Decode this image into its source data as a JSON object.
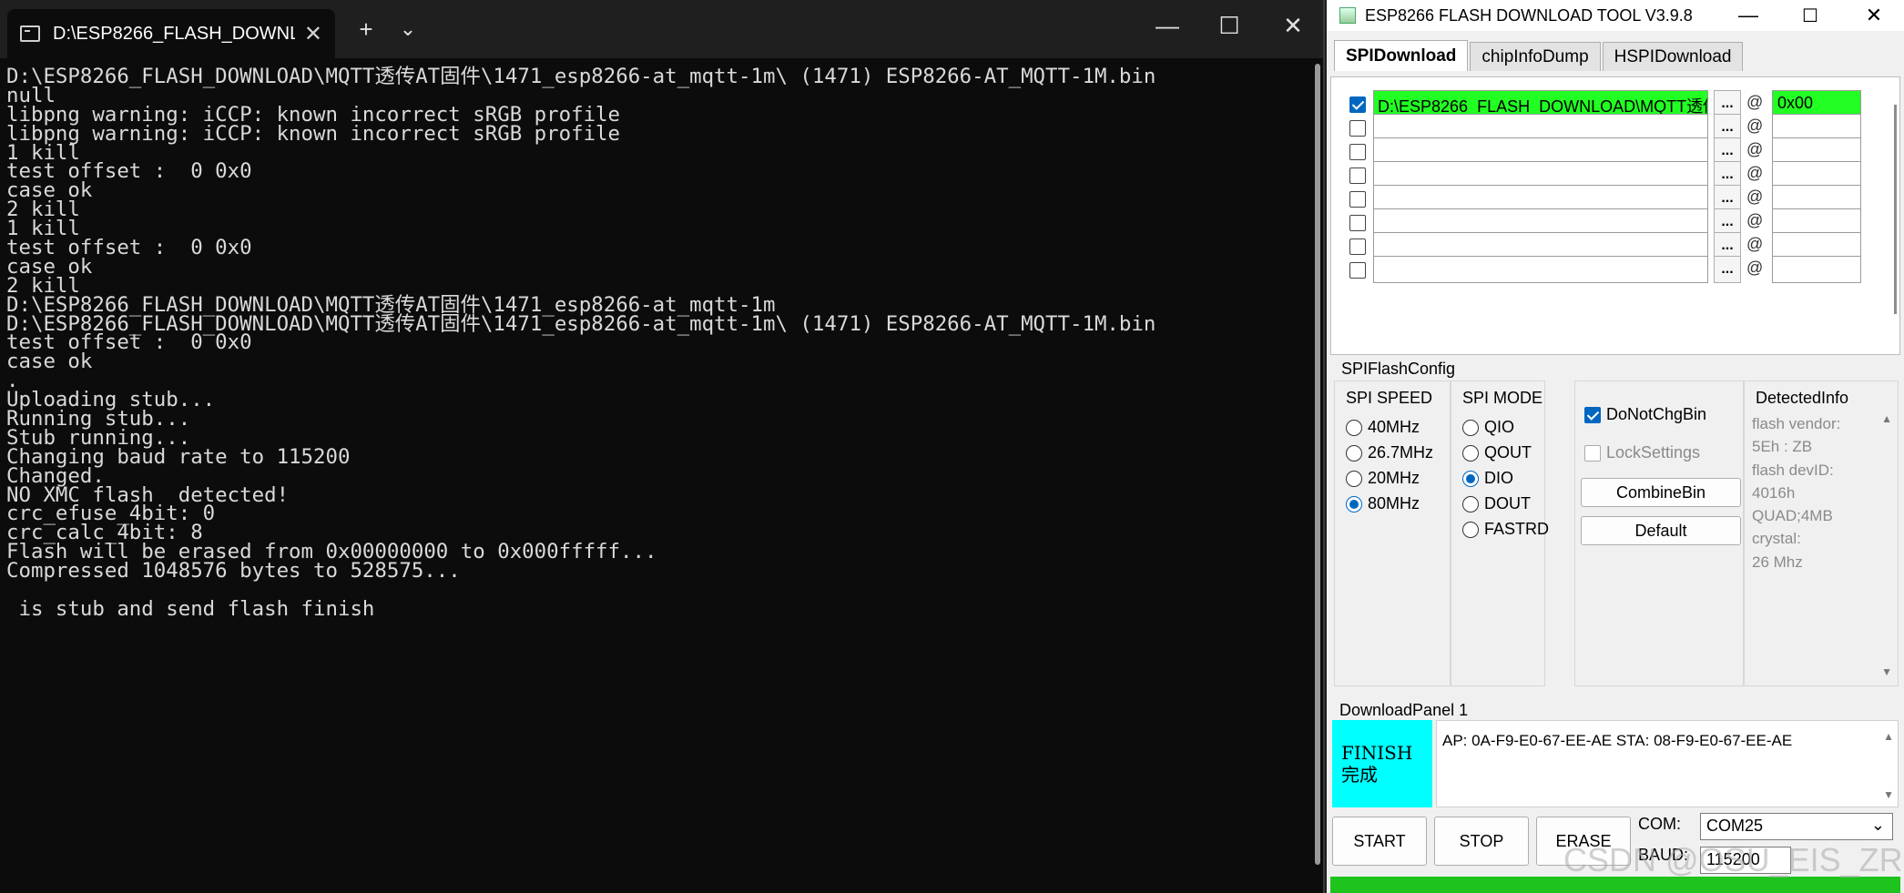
{
  "terminal": {
    "tab_title": "D:\\ESP8266_FLASH_DOWNLO...",
    "new_tab": "+",
    "dropdown": "⌄",
    "minimize": "—",
    "maximize": "☐",
    "close": "✕",
    "lines": [
      "D:\\ESP8266_FLASH_DOWNLOAD\\MQTT透传AT固件\\1471_esp8266-at_mqtt-1m\\ (1471) ESP8266-AT_MQTT-1M.bin",
      "null",
      "libpng warning: iCCP: known incorrect sRGB profile",
      "libpng warning: iCCP: known incorrect sRGB profile",
      "1 kill",
      "test offset :  0 0x0",
      "case ok",
      "2 kill",
      "1 kill",
      "test offset :  0 0x0",
      "case ok",
      "2 kill",
      "D:\\ESP8266_FLASH_DOWNLOAD\\MQTT透传AT固件\\1471_esp8266-at_mqtt-1m",
      "D:\\ESP8266_FLASH_DOWNLOAD\\MQTT透传AT固件\\1471_esp8266-at_mqtt-1m\\ (1471) ESP8266-AT_MQTT-1M.bin",
      "test offset :  0 0x0",
      "case ok",
      ".",
      "Uploading stub...",
      "Running stub...",
      "Stub running...",
      "Changing baud rate to 115200",
      "Changed.",
      "NO XMC flash  detected!",
      "crc_efuse_4bit: 0",
      "crc_calc_4bit: 8",
      "Flash will be erased from 0x00000000 to 0x000fffff...",
      "Compressed 1048576 bytes to 528575...",
      "",
      " is stub and send flash finish"
    ]
  },
  "tool": {
    "title": "ESP8266 FLASH DOWNLOAD TOOL V3.9.8",
    "minimize": "—",
    "maximize": "☐",
    "close": "✕",
    "tabs": [
      "SPIDownload",
      "chipInfoDump",
      "HSPIDownload"
    ],
    "file_rows": [
      {
        "checked": true,
        "path": "D:\\ESP8266_FLASH_DOWNLOAD\\MQTT透传",
        "address": "0x00"
      },
      {
        "checked": false,
        "path": "",
        "address": ""
      },
      {
        "checked": false,
        "path": "",
        "address": ""
      },
      {
        "checked": false,
        "path": "",
        "address": ""
      },
      {
        "checked": false,
        "path": "",
        "address": ""
      },
      {
        "checked": false,
        "path": "",
        "address": ""
      },
      {
        "checked": false,
        "path": "",
        "address": ""
      },
      {
        "checked": false,
        "path": "",
        "address": ""
      }
    ],
    "browse_label": "...",
    "at_label": "@",
    "spi_flash_config": "SPIFlashConfig",
    "spi_speed": {
      "title": "SPI SPEED",
      "options": [
        "40MHz",
        "26.7MHz",
        "20MHz",
        "80MHz"
      ],
      "selected": "80MHz"
    },
    "spi_mode": {
      "title": "SPI MODE",
      "options": [
        "QIO",
        "QOUT",
        "DIO",
        "DOUT",
        "FASTRD"
      ],
      "selected": "DIO"
    },
    "options": {
      "do_not_chg_bin": "DoNotChgBin",
      "lock_settings": "LockSettings",
      "combine_bin": "CombineBin",
      "default": "Default"
    },
    "detected_info": {
      "title": "DetectedInfo",
      "lines": [
        "flash vendor:",
        "5Eh : ZB",
        "flash devID:",
        "4016h",
        "QUAD;4MB",
        "crystal:",
        "26 Mhz"
      ]
    },
    "download_panel": {
      "title": "DownloadPanel 1",
      "status_line1": "FINISH",
      "status_line2": "完成",
      "info": "AP:  0A-F9-E0-67-EE-AE  STA:  08-F9-E0-67-EE-AE"
    },
    "buttons": {
      "start": "START",
      "stop": "STOP",
      "erase": "ERASE"
    },
    "com_label": "COM:",
    "com_value": "COM25",
    "baud_label": "BAUD:",
    "baud_value": "115200",
    "progress": 1.0,
    "watermark": "CSDN @OSU_EIS_ZR",
    "colors": {
      "ok_green": "#22ff22",
      "finish_cyan": "#00ffff",
      "progress_green": "#1ec31e"
    }
  }
}
